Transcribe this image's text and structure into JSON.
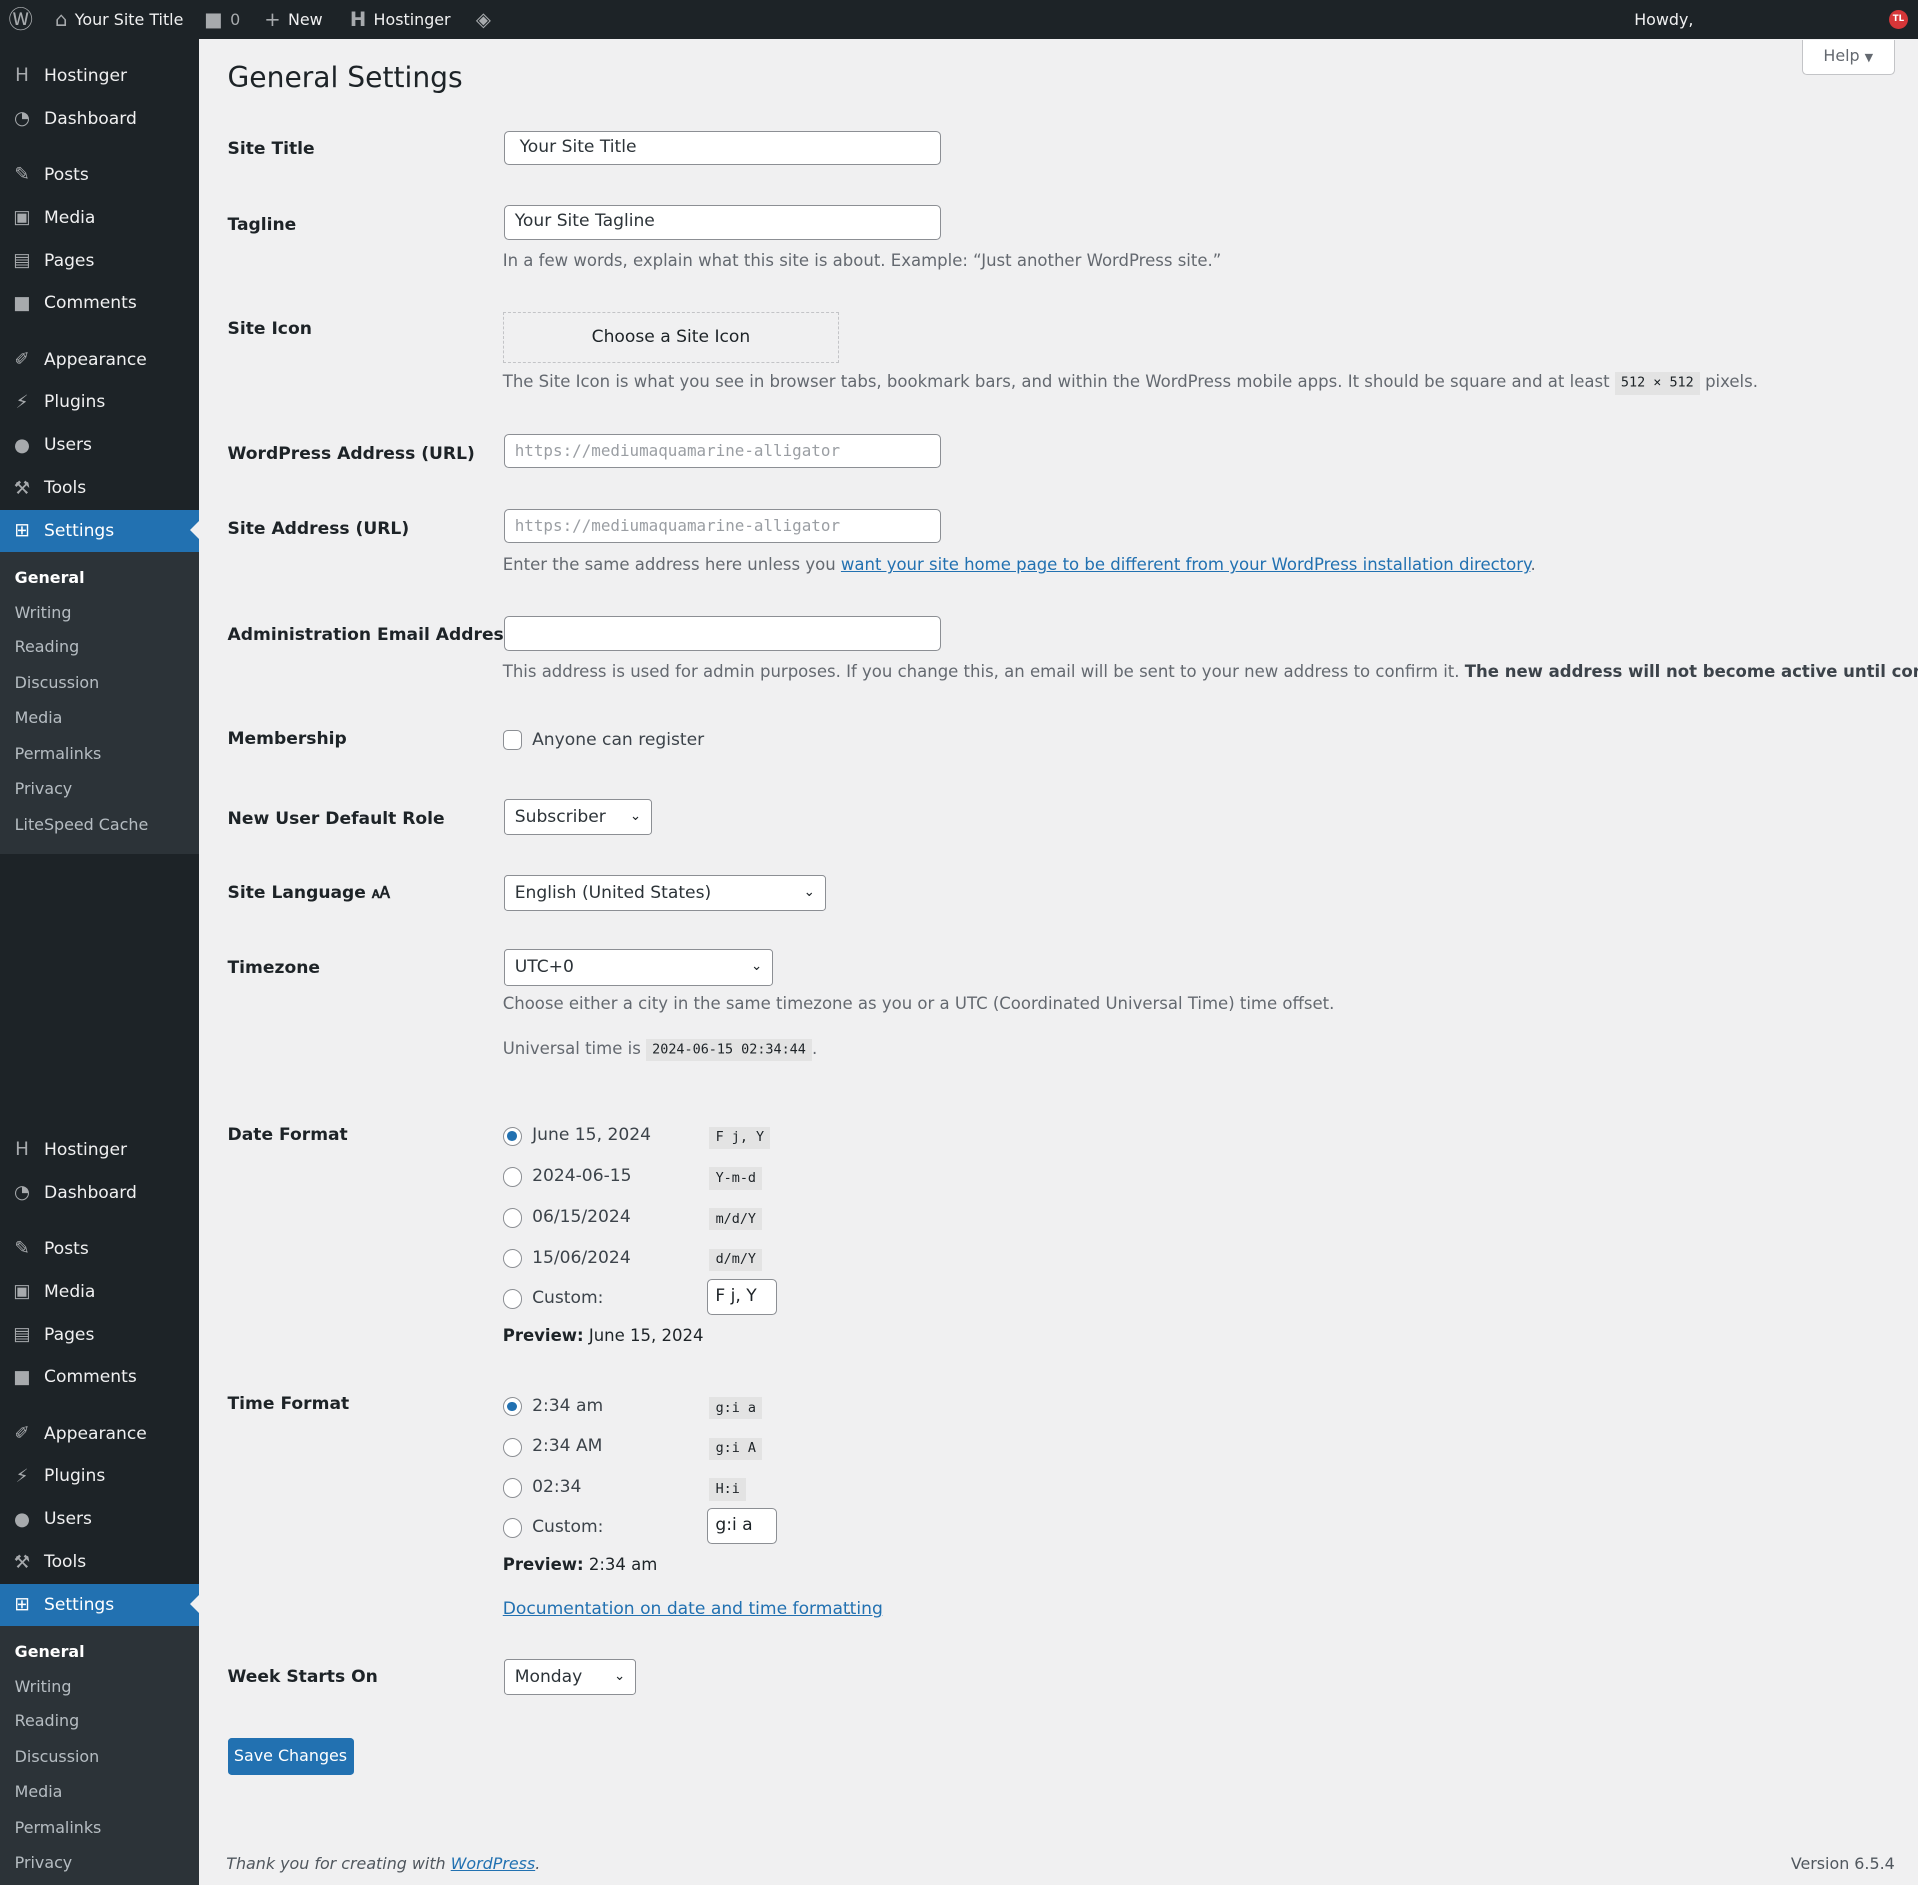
{
  "adminbar": {
    "site_title": "Your Site Title",
    "comments_count": "0",
    "new_label": "New",
    "hostinger_label": "Hostinger",
    "howdy": "Howdy,",
    "avatar_initials": "TL"
  },
  "help_label": "Help",
  "sidebar": {
    "menu": [
      {
        "label": "Hostinger",
        "icon": "hostinger-icon",
        "glyph": "H"
      },
      {
        "label": "Dashboard",
        "icon": "dashboard-icon",
        "glyph": "◔"
      },
      {
        "label": "Posts",
        "icon": "pin-icon",
        "glyph": "✎"
      },
      {
        "label": "Media",
        "icon": "media-icon",
        "glyph": "▣"
      },
      {
        "label": "Pages",
        "icon": "pages-icon",
        "glyph": "▤"
      },
      {
        "label": "Comments",
        "icon": "comment-icon",
        "glyph": "■"
      },
      {
        "label": "Appearance",
        "icon": "brush-icon",
        "glyph": "✐"
      },
      {
        "label": "Plugins",
        "icon": "plugin-icon",
        "glyph": "⚡"
      },
      {
        "label": "Users",
        "icon": "user-icon",
        "glyph": "●"
      },
      {
        "label": "Tools",
        "icon": "wrench-icon",
        "glyph": "⚒"
      },
      {
        "label": "Settings",
        "icon": "settings-icon",
        "glyph": "⊞",
        "current": true
      }
    ],
    "submenu": [
      "General",
      "Writing",
      "Reading",
      "Discussion",
      "Media",
      "Permalinks",
      "Privacy",
      "LiteSpeed Cache"
    ]
  },
  "page_title": "General Settings",
  "form": {
    "site_title": {
      "label": "Site Title",
      "value": "Your Site Title"
    },
    "tagline": {
      "label": "Tagline",
      "value": "Your Site Tagline",
      "desc": "In a few words, explain what this site is about. Example: “Just another WordPress site.”"
    },
    "site_icon": {
      "label": "Site Icon",
      "button": "Choose a Site Icon",
      "desc_pre": "The Site Icon is what you see in browser tabs, bookmark bars, and within the WordPress mobile apps. It should be square and at least",
      "size": "512 × 512",
      "desc_post": "pixels."
    },
    "wp_address": {
      "label": "WordPress Address (URL)",
      "value": "https://mediumaquamarine-alligator"
    },
    "site_address": {
      "label": "Site Address (URL)",
      "value": "https://mediumaquamarine-alligator",
      "desc_pre": "Enter the same address here unless you",
      "desc_link": "want your site home page to be different from your WordPress installation directory",
      "desc_post": "."
    },
    "admin_email": {
      "label": "Administration Email Address",
      "value": "",
      "desc": "This address is used for admin purposes. If you change this, an email will be sent to your new address to confirm it.",
      "desc_bold": "The new address will not become active until confirmed."
    },
    "membership": {
      "label": "Membership",
      "checkbox": "Anyone can register",
      "checked": false
    },
    "default_role": {
      "label": "New User Default Role",
      "value": "Subscriber"
    },
    "language": {
      "label": "Site Language",
      "value": "English (United States)"
    },
    "timezone": {
      "label": "Timezone",
      "value": "UTC+0",
      "desc": "Choose either a city in the same timezone as you or a UTC (Coordinated Universal Time) time offset.",
      "universal_label": "Universal time is",
      "universal_value": "2024-06-15 02:34:44",
      "universal_post": "."
    },
    "date_format": {
      "label": "Date Format",
      "options": [
        {
          "label": "June 15, 2024",
          "code": "F j, Y",
          "checked": true
        },
        {
          "label": "2024-06-15",
          "code": "Y-m-d"
        },
        {
          "label": "06/15/2024",
          "code": "m/d/Y"
        },
        {
          "label": "15/06/2024",
          "code": "d/m/Y"
        }
      ],
      "custom_label": "Custom:",
      "custom_value": "F j, Y",
      "preview_label": "Preview:",
      "preview_value": "June 15, 2024"
    },
    "time_format": {
      "label": "Time Format",
      "options": [
        {
          "label": "2:34 am",
          "code": "g:i a",
          "checked": true
        },
        {
          "label": "2:34 AM",
          "code": "g:i A"
        },
        {
          "label": "02:34",
          "code": "H:i"
        }
      ],
      "custom_label": "Custom:",
      "custom_value": "g:i a",
      "preview_label": "Preview:",
      "preview_value": "2:34 am",
      "doc_link": "Documentation on date and time formatting"
    },
    "week_start": {
      "label": "Week Starts On",
      "value": "Monday"
    },
    "save": "Save Changes"
  },
  "footer": {
    "thanks": "Thank you for creating with",
    "wp_link": "WordPress",
    "thanks_post": ".",
    "version": "Version 6.5.4"
  },
  "colors": {
    "accent": "#2271b1",
    "adminbar": "#1d2327",
    "submenu": "#2c3338"
  }
}
